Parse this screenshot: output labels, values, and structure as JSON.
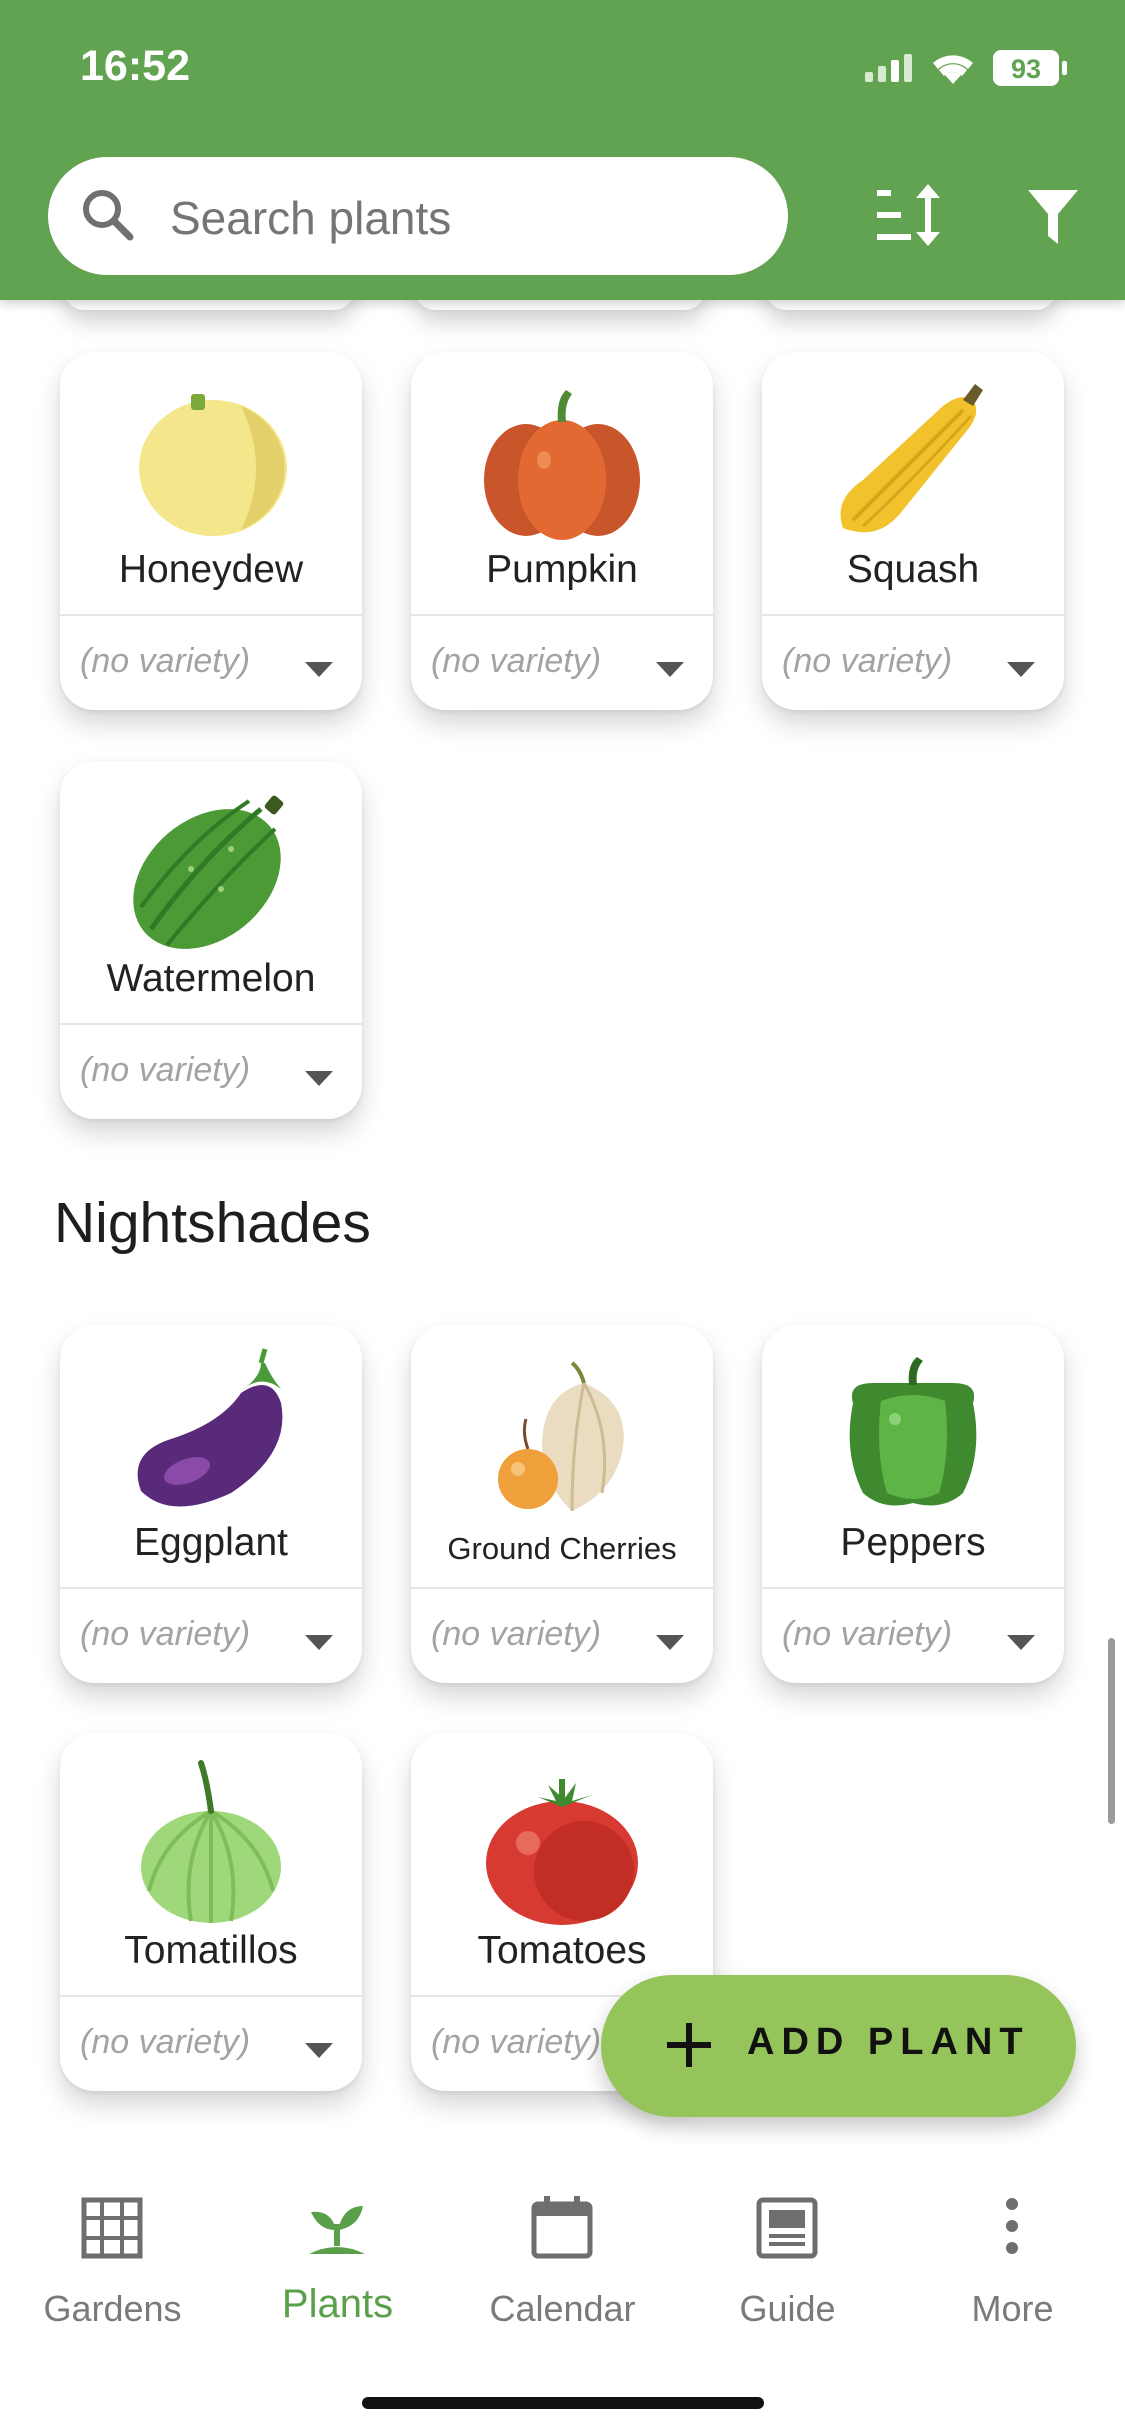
{
  "status_bar": {
    "time": "16:52",
    "battery": "93"
  },
  "search": {
    "placeholder": "Search plants"
  },
  "toolbar": {
    "sort_icon": "sort-icon",
    "filter_icon": "filter-icon"
  },
  "sections": [
    {
      "title": "",
      "plants": [
        {
          "name": "Honeydew",
          "variety": "(no variety)",
          "icon": "honeydew-icon"
        },
        {
          "name": "Pumpkin",
          "variety": "(no variety)",
          "icon": "pumpkin-icon"
        },
        {
          "name": "Squash",
          "variety": "(no variety)",
          "icon": "squash-icon"
        },
        {
          "name": "Watermelon",
          "variety": "(no variety)",
          "icon": "watermelon-icon"
        }
      ]
    },
    {
      "title": "Nightshades",
      "plants": [
        {
          "name": "Eggplant",
          "variety": "(no variety)",
          "icon": "eggplant-icon"
        },
        {
          "name": "Ground Cherries",
          "variety": "(no variety)",
          "icon": "ground-cherries-icon"
        },
        {
          "name": "Peppers",
          "variety": "(no variety)",
          "icon": "pepper-icon"
        },
        {
          "name": "Tomatillos",
          "variety": "(no variety)",
          "icon": "tomatillo-icon"
        },
        {
          "name": "Tomatoes",
          "variety": "(no variety)",
          "icon": "tomato-icon"
        }
      ]
    }
  ],
  "fab": {
    "label": "ADD PLANT"
  },
  "nav": [
    {
      "label": "Gardens",
      "icon": "grid-icon"
    },
    {
      "label": "Plants",
      "icon": "sprout-icon",
      "active": true
    },
    {
      "label": "Calendar",
      "icon": "calendar-icon"
    },
    {
      "label": "Guide",
      "icon": "guide-icon"
    },
    {
      "label": "More",
      "icon": "more-icon"
    }
  ],
  "colors": {
    "header": "#62a352",
    "fab": "#95c45b",
    "active_nav": "#5aa04a"
  }
}
